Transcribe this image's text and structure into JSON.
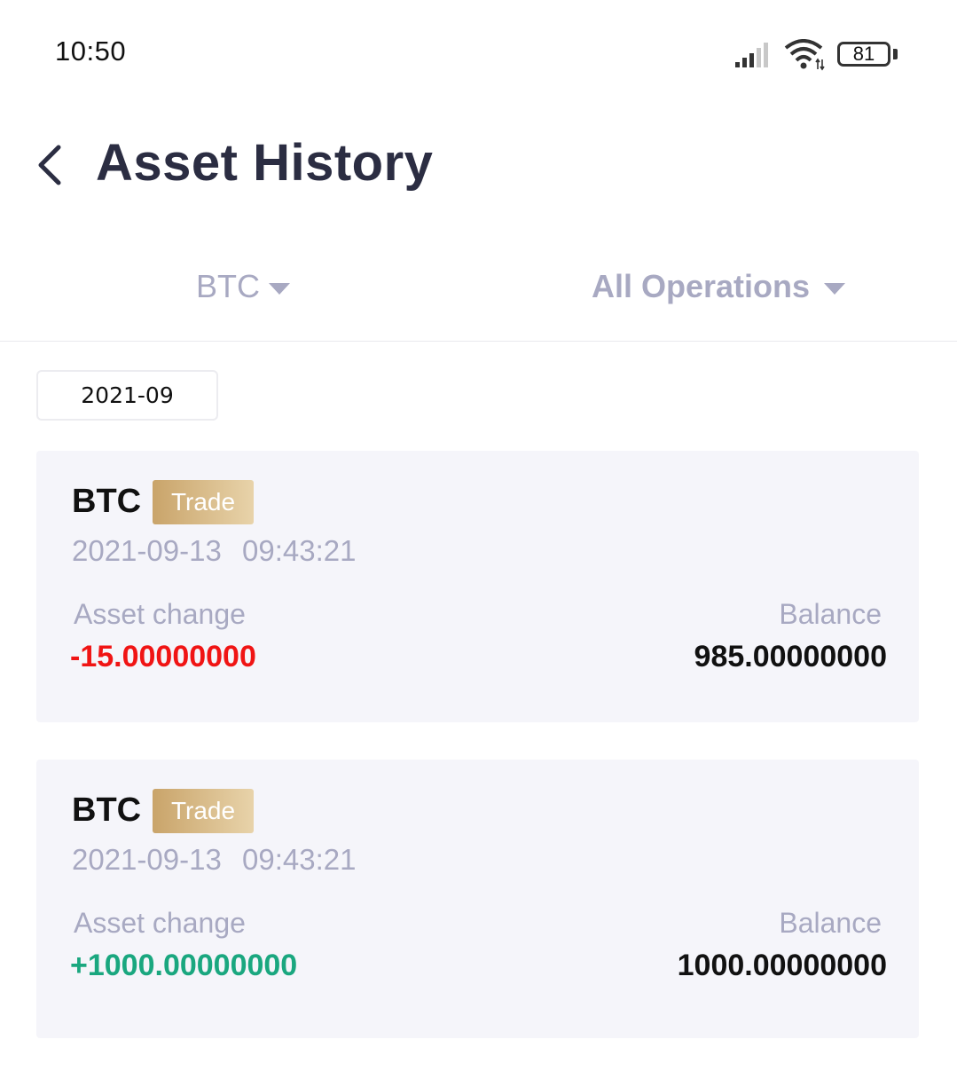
{
  "status_bar": {
    "time": "10:50",
    "battery": "81"
  },
  "header": {
    "title": "Asset History"
  },
  "filters": {
    "coin": "BTC",
    "operation": "All Operations"
  },
  "month": "2021-09",
  "records": [
    {
      "coin": "BTC",
      "type": "Trade",
      "date": "2021-09-13",
      "time": "09:43:21",
      "change_label": "Asset change",
      "change": "-15.00000000",
      "balance_label": "Balance",
      "balance": "985.00000000"
    },
    {
      "coin": "BTC",
      "type": "Trade",
      "date": "2021-09-13",
      "time": "09:43:21",
      "change_label": "Asset change",
      "change": "+1000.00000000",
      "balance_label": "Balance",
      "balance": "1000.00000000"
    }
  ],
  "colors": {
    "negative": "#f01414",
    "positive": "#1aa77f",
    "title": "#2b2d42",
    "muted": "#a8a9c2",
    "badge": "#c9a46a"
  },
  "icons": [
    "back-chevron-icon",
    "signal-icon",
    "wifi-icon",
    "battery-icon",
    "caret-down-icon"
  ]
}
